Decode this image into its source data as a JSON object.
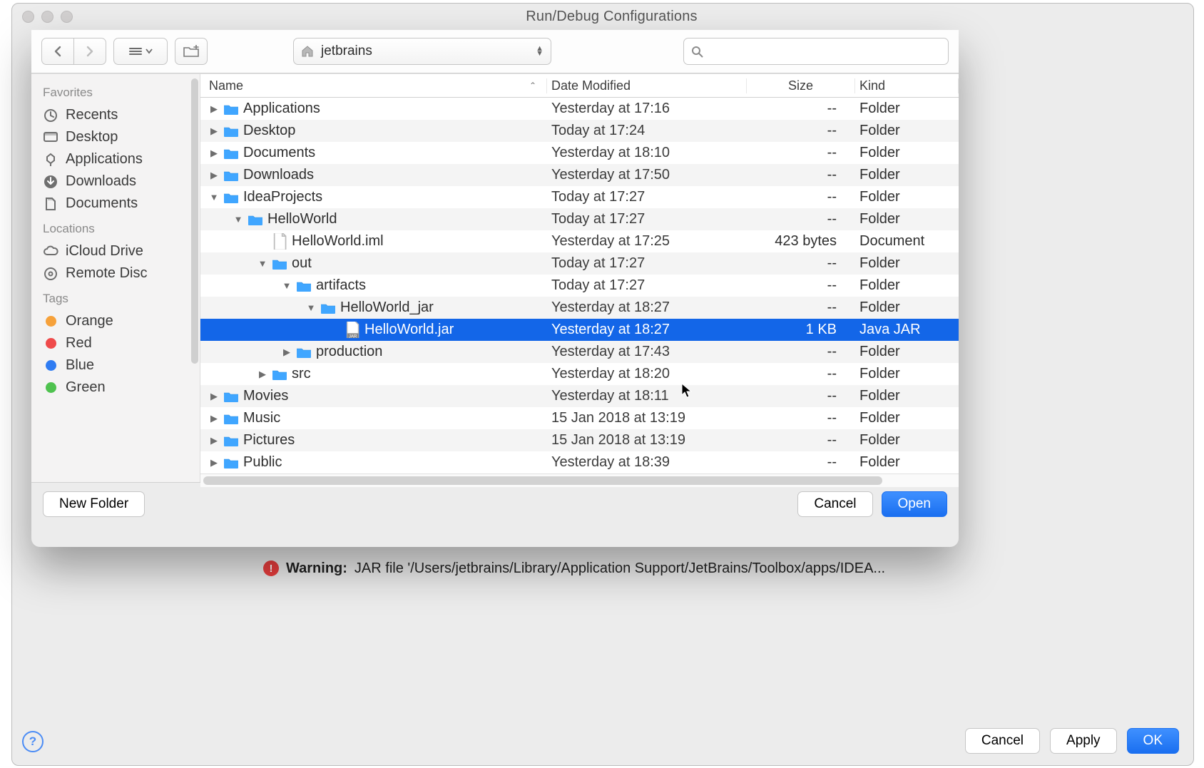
{
  "window_title": "Run/Debug Configurations",
  "warning_label": "Warning:",
  "warning_text": "JAR file '/Users/jetbrains/Library/Application Support/JetBrains/Toolbox/apps/IDEA...",
  "outer_buttons": {
    "cancel": "Cancel",
    "apply": "Apply",
    "ok": "OK"
  },
  "toolbar": {
    "location": "jetbrains",
    "search_placeholder": ""
  },
  "sidebar": {
    "favorites_head": "Favorites",
    "favorites": [
      {
        "label": "Recents",
        "icon": "recents"
      },
      {
        "label": "Desktop",
        "icon": "desktop"
      },
      {
        "label": "Applications",
        "icon": "applications"
      },
      {
        "label": "Downloads",
        "icon": "downloads"
      },
      {
        "label": "Documents",
        "icon": "documents"
      }
    ],
    "locations_head": "Locations",
    "locations": [
      {
        "label": "iCloud Drive",
        "icon": "icloud"
      },
      {
        "label": "Remote Disc",
        "icon": "disc"
      }
    ],
    "tags_head": "Tags",
    "tags": [
      {
        "label": "Orange",
        "color": "#f6a13a"
      },
      {
        "label": "Red",
        "color": "#ef4a4a"
      },
      {
        "label": "Blue",
        "color": "#2f7cf2"
      },
      {
        "label": "Green",
        "color": "#4fc24f"
      }
    ]
  },
  "columns": {
    "name": "Name",
    "date": "Date Modified",
    "size": "Size",
    "kind": "Kind"
  },
  "rows": [
    {
      "depth": 0,
      "arrow": "right",
      "icon": "folder",
      "name": "Applications",
      "date": "Yesterday at 17:16",
      "size": "--",
      "kind": "Folder"
    },
    {
      "depth": 0,
      "arrow": "right",
      "icon": "folder",
      "name": "Desktop",
      "date": "Today at 17:24",
      "size": "--",
      "kind": "Folder"
    },
    {
      "depth": 0,
      "arrow": "right",
      "icon": "folder",
      "name": "Documents",
      "date": "Yesterday at 18:10",
      "size": "--",
      "kind": "Folder"
    },
    {
      "depth": 0,
      "arrow": "right",
      "icon": "folder",
      "name": "Downloads",
      "date": "Yesterday at 17:50",
      "size": "--",
      "kind": "Folder"
    },
    {
      "depth": 0,
      "arrow": "down",
      "icon": "folder",
      "name": "IdeaProjects",
      "date": "Today at 17:27",
      "size": "--",
      "kind": "Folder"
    },
    {
      "depth": 1,
      "arrow": "down",
      "icon": "folder",
      "name": "HelloWorld",
      "date": "Today at 17:27",
      "size": "--",
      "kind": "Folder"
    },
    {
      "depth": 2,
      "arrow": "",
      "icon": "file",
      "name": "HelloWorld.iml",
      "date": "Yesterday at 17:25",
      "size": "423 bytes",
      "kind": "Document"
    },
    {
      "depth": 2,
      "arrow": "down",
      "icon": "folder",
      "name": "out",
      "date": "Today at 17:27",
      "size": "--",
      "kind": "Folder"
    },
    {
      "depth": 3,
      "arrow": "down",
      "icon": "folder",
      "name": "artifacts",
      "date": "Today at 17:27",
      "size": "--",
      "kind": "Folder"
    },
    {
      "depth": 4,
      "arrow": "down",
      "icon": "folder",
      "name": "HelloWorld_jar",
      "date": "Yesterday at 18:27",
      "size": "--",
      "kind": "Folder"
    },
    {
      "depth": 5,
      "arrow": "",
      "icon": "jar",
      "name": "HelloWorld.jar",
      "date": "Yesterday at 18:27",
      "size": "1 KB",
      "kind": "Java JAR ",
      "selected": true
    },
    {
      "depth": 3,
      "arrow": "right",
      "icon": "folder",
      "name": "production",
      "date": "Yesterday at 17:43",
      "size": "--",
      "kind": "Folder"
    },
    {
      "depth": 2,
      "arrow": "right",
      "icon": "folder",
      "name": "src",
      "date": "Yesterday at 18:20",
      "size": "--",
      "kind": "Folder"
    },
    {
      "depth": 0,
      "arrow": "right",
      "icon": "mfolder",
      "name": "Movies",
      "date": "Yesterday at 18:11",
      "size": "--",
      "kind": "Folder"
    },
    {
      "depth": 0,
      "arrow": "right",
      "icon": "mfolder",
      "name": "Music",
      "date": "15 Jan 2018 at 13:19",
      "size": "--",
      "kind": "Folder"
    },
    {
      "depth": 0,
      "arrow": "right",
      "icon": "mfolder",
      "name": "Pictures",
      "date": "15 Jan 2018 at 13:19",
      "size": "--",
      "kind": "Folder"
    },
    {
      "depth": 0,
      "arrow": "right",
      "icon": "mfolder",
      "name": "Public",
      "date": "Yesterday at 18:39",
      "size": "--",
      "kind": "Folder"
    }
  ],
  "sheet_buttons": {
    "new_folder": "New Folder",
    "cancel": "Cancel",
    "open": "Open"
  }
}
